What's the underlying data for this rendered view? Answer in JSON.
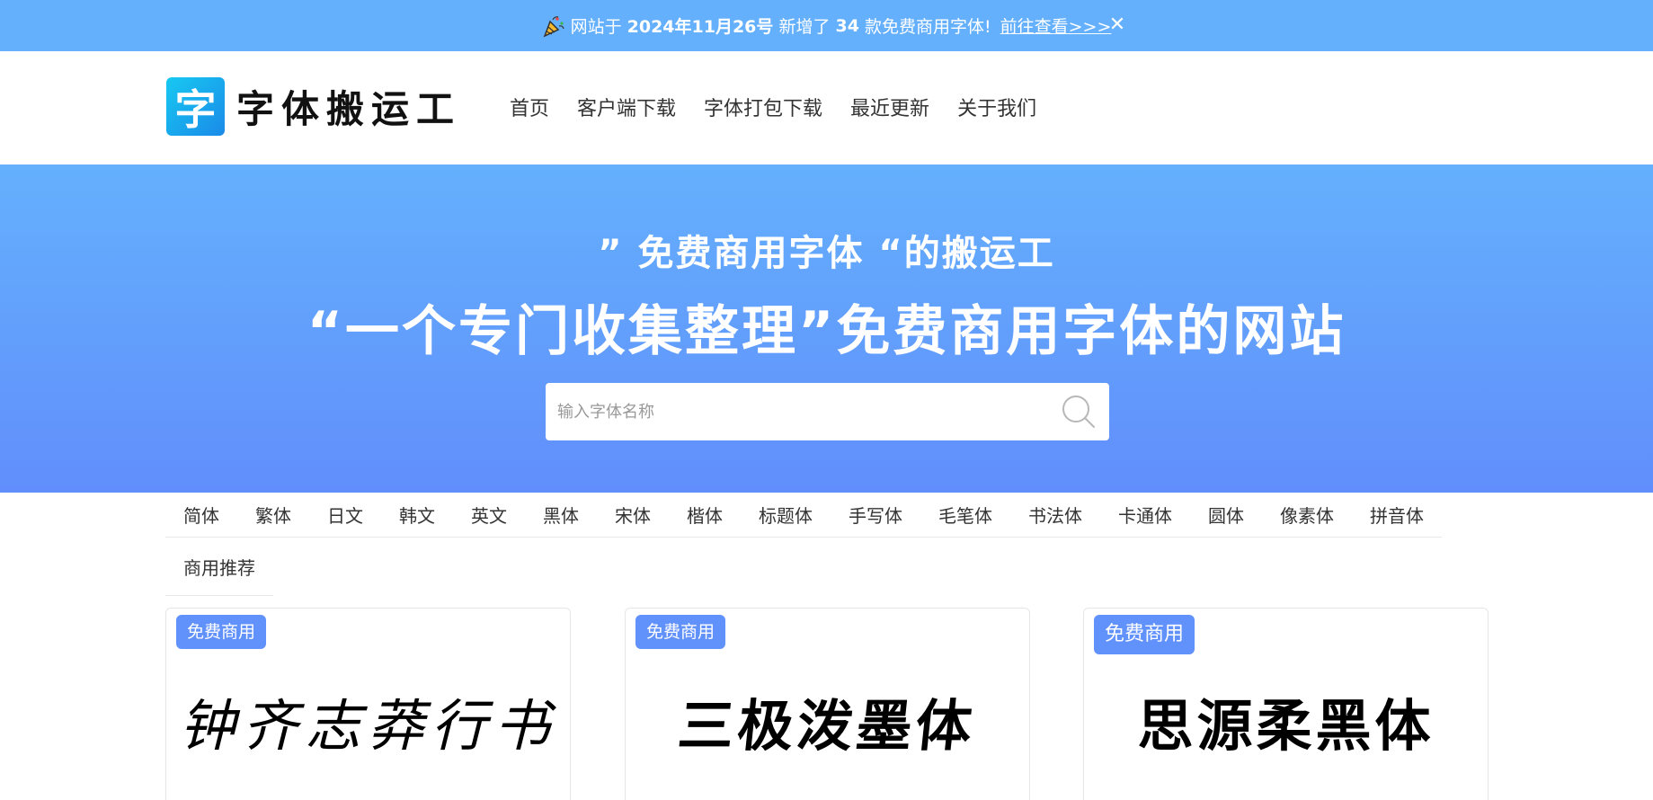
{
  "announcement": {
    "prefix": "网站于",
    "date": "2024年11月26号",
    "middle": "新增了",
    "count": "34",
    "suffix": "款免费商用字体!",
    "link": "前往查看>>>",
    "close": "✕"
  },
  "logo": {
    "mark": "字",
    "text": "字体搬运工"
  },
  "nav": [
    "首页",
    "客户端下载",
    "字体打包下载",
    "最近更新",
    "关于我们"
  ],
  "hero": {
    "subtitle": "” 免费商用字体 “的搬运工",
    "title": "“一个专门收集整理”免费商用字体的网站"
  },
  "search": {
    "placeholder": "输入字体名称"
  },
  "categories": {
    "row1": [
      "简体",
      "繁体",
      "日文",
      "韩文",
      "英文",
      "黑体",
      "宋体",
      "楷体",
      "标题体",
      "手写体",
      "毛笔体",
      "书法体",
      "卡通体",
      "圆体",
      "像素体",
      "拼音体"
    ],
    "row2": [
      "商用推荐"
    ]
  },
  "cards": [
    {
      "badge": "免费商用",
      "preview": "钟齐志莽行书"
    },
    {
      "badge": "免费商用",
      "preview": "三极泼墨体"
    },
    {
      "badge": "免费商用",
      "preview": "思源柔黑体"
    }
  ],
  "colors": {
    "announce": "#64b0fd",
    "hero_top": "#64b0fd",
    "hero_bottom": "#618efc",
    "badge": "#6191fb"
  }
}
